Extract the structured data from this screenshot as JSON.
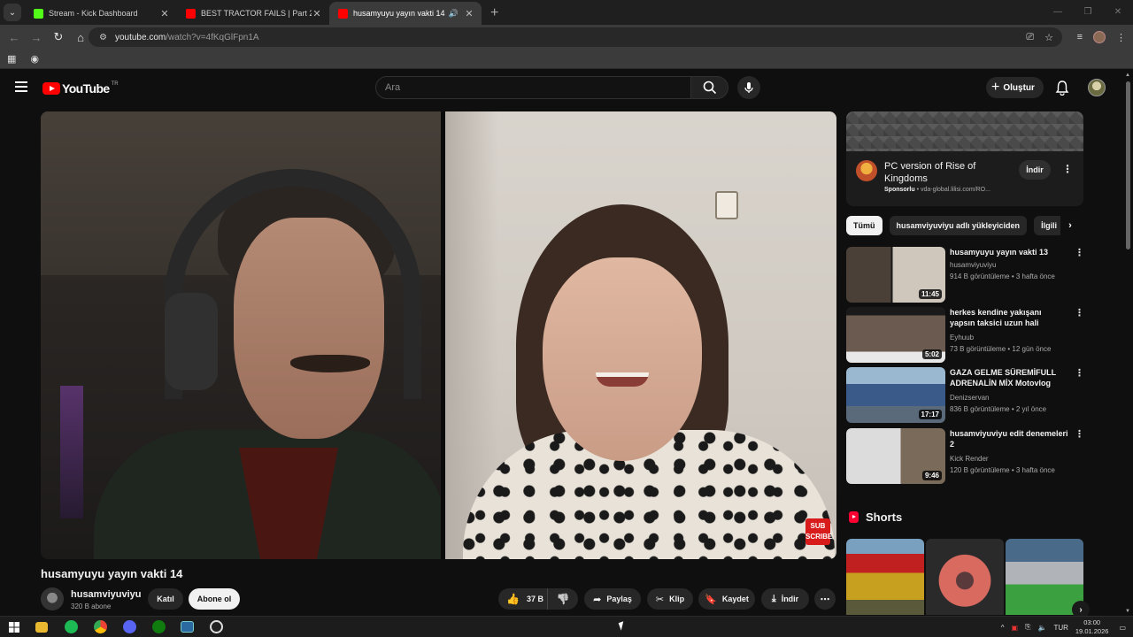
{
  "browser": {
    "tabs": [
      {
        "title": "Stream - Kick Dashboard",
        "favicon_color": "#53fc18",
        "active": false
      },
      {
        "title": "BEST TRACTOR FAILS | Part 2 -",
        "favicon_color": "#ff0000",
        "active": false
      },
      {
        "title": "husamyuyu yayın vakti 14",
        "favicon_color": "#ff0000",
        "active": true
      }
    ],
    "url_host": "youtube.com",
    "url_path": "/watch?v=4fKqGlFpn1A"
  },
  "youtube": {
    "logo_text": "YouTube",
    "country_code": "TR",
    "search_placeholder": "Ara",
    "create_label": "Oluştur"
  },
  "video": {
    "title": "husamyuyu yayın vakti 14",
    "overlay_badge": "SUB SCRIBE",
    "channel_name": "husamviyuviyu",
    "subscribers": "320 B abone",
    "join_label": "Katıl",
    "subscribe_label": "Abone ol",
    "like_count": "37 B",
    "share_label": "Paylaş",
    "clip_label": "Klip",
    "save_label": "Kaydet",
    "download_label": "İndir"
  },
  "ad": {
    "title": "PC version of Rise of Kingdoms",
    "sponsored": "Sponsorlu",
    "domain": "vda-global.lilisi.com/RO...",
    "cta": "İndir"
  },
  "chips": [
    "Tümü",
    "husamviyuviyu adlı yükleyiciden",
    "İlgili"
  ],
  "recommendations": [
    {
      "title": "husamyuyu yayın vakti 13",
      "channel": "husamviyuviyu",
      "meta": "914 B görüntüleme • 3 hafta önce",
      "duration": "11:45"
    },
    {
      "title": "herkes kendine yakışanı yapsın taksici  uzun hali",
      "channel": "Eyhuub",
      "meta": "73 B görüntüleme • 12 gün önce",
      "duration": "5:02"
    },
    {
      "title": "GAZA GELME SÜREMİFULL ADRENALİN MİX Motovlog",
      "channel": "Denizservan",
      "meta": "836 B görüntüleme • 2 yıl önce",
      "duration": "17:17"
    },
    {
      "title": "husamviyuviyu edit denemeleri 2",
      "channel": "Kick Render",
      "meta": "120 B görüntüleme • 3 hafta önce",
      "duration": "9:46"
    }
  ],
  "shorts_label": "Shorts",
  "taskbar": {
    "language": "TUR",
    "time": "03:00",
    "date": "19.01.2026"
  }
}
